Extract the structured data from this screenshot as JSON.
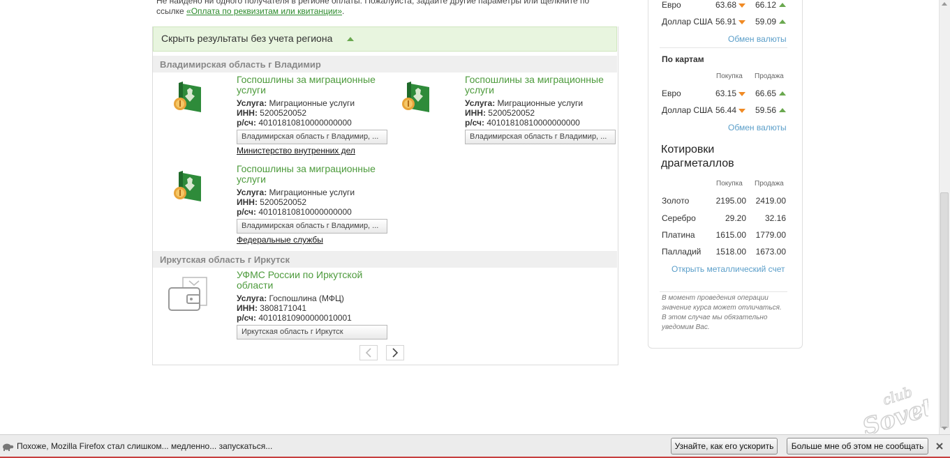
{
  "notice": {
    "line1": "Не найдено ни одного получателя в регионе оплаты. Пожалуйста, задайте другие параметры или щелкните по",
    "line2_prefix": "ссылке ",
    "line2_link": "«Оплата по реквизитам или квитанции»",
    "line2_suffix": "."
  },
  "hide_results_label": "Скрыть результаты без учета региона",
  "regions": [
    {
      "name": "Владимирская область г Владимир",
      "cards": [
        {
          "title": "Госпошлины за миграционные услуги",
          "service_label": "Услуга:",
          "service": "Миграционные услуги",
          "inn_label": "ИНН:",
          "inn": "5200520052",
          "account_label": "р/сч:",
          "account": "40101810810000000000",
          "region_button": "Владимирская область г Владимир, ..."
        },
        {
          "title": "Госпошлины за миграционные услуги",
          "service_label": "Услуга:",
          "service": "Миграционные услуги",
          "inn_label": "ИНН:",
          "inn": "5200520052",
          "account_label": "р/сч:",
          "account": "40101810810000000000",
          "region_button": "Владимирская область г Владимир, ..."
        },
        {
          "title": "Госпошлины за миграционные услуги",
          "service_label": "Услуга:",
          "service": "Миграционные услуги",
          "inn_label": "ИНН:",
          "inn": "5200520052",
          "account_label": "р/сч:",
          "account": "40101810810000000000",
          "region_button": "Владимирская область г Владимир, ..."
        }
      ],
      "category_links": [
        "Министерство внутренних дел",
        "Федеральные службы"
      ]
    },
    {
      "name": "Иркутская область г Иркутск",
      "cards": [
        {
          "title": "УФМС России по Иркутской области",
          "service_label": "Услуга:",
          "service": "Госпошлина (МФЦ)",
          "inn_label": "ИНН:",
          "inn": "3808171041",
          "account_label": "р/сч:",
          "account": "40101810900000010001",
          "region_button": "Иркутская область г Иркутск"
        }
      ]
    }
  ],
  "sidebar": {
    "cash_rates": [
      {
        "currency": "Евро",
        "buy": "63.68",
        "sell": "66.12"
      },
      {
        "currency": "Доллар США",
        "buy": "56.91",
        "sell": "59.09"
      }
    ],
    "exchange_link": "Обмен валюты",
    "cards_title": "По картам",
    "col_buy": "Покупка",
    "col_sell": "Продажа",
    "card_rates": [
      {
        "currency": "Евро",
        "buy": "63.15",
        "sell": "66.65"
      },
      {
        "currency": "Доллар США",
        "buy": "56.44",
        "sell": "59.56"
      }
    ],
    "metals_title_1": "Котировки",
    "metals_title_2": "драгметаллов",
    "metals": [
      {
        "name": "Золото",
        "buy": "2195.00",
        "sell": "2419.00"
      },
      {
        "name": "Серебро",
        "buy": "29.20",
        "sell": "32.16"
      },
      {
        "name": "Платина",
        "buy": "1615.00",
        "sell": "1779.00"
      },
      {
        "name": "Палладий",
        "buy": "1518.00",
        "sell": "1673.00"
      }
    ],
    "metal_account_link": "Открыть металлический счет",
    "note": "В момент проведения операции значение курса может отличаться. В этом случае мы обязательно уведомим Вас."
  },
  "notification_bar": {
    "message": "Похоже, Mozilla Firefox стал слишком... медленно... запускаться...",
    "speed_up_button": "Узнайте, как его ускорить",
    "dont_tell_button": "Больше мне об этом не сообщать"
  },
  "colors": {
    "accent_green": "#4c9a3b",
    "link_blue": "#5a9ec9",
    "down_arrow": "#f08a24",
    "up_arrow": "#6aa84f"
  }
}
